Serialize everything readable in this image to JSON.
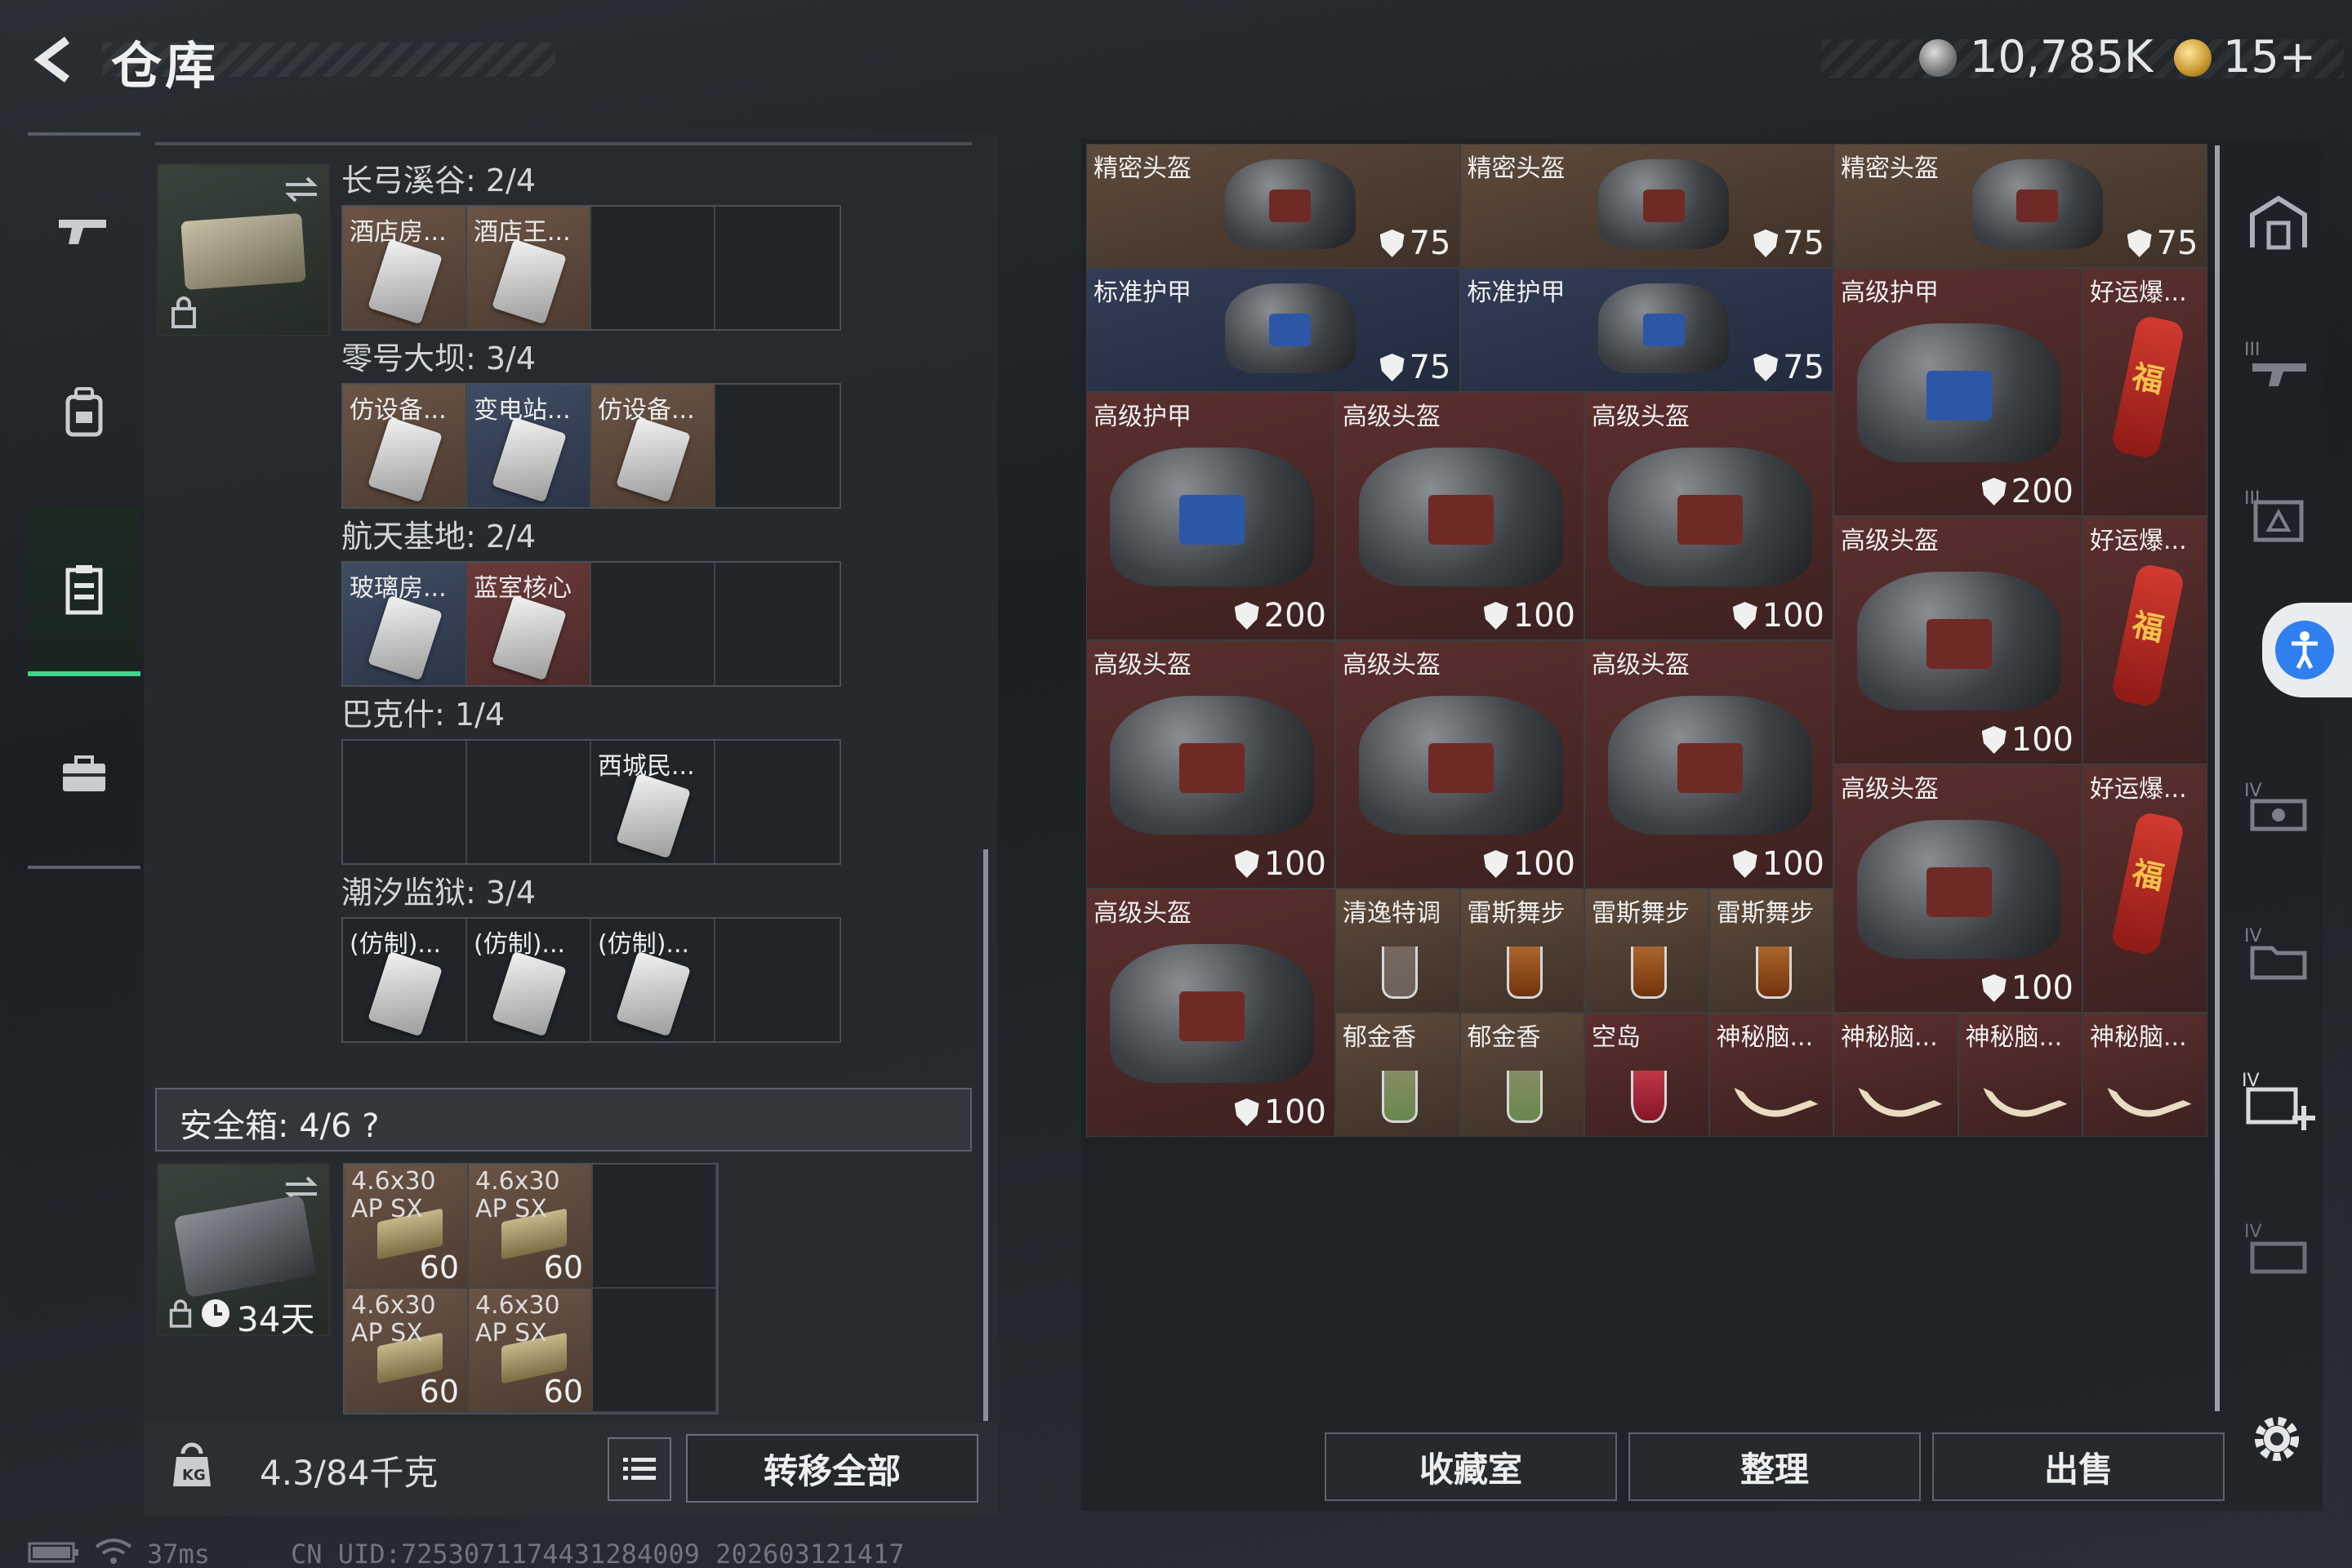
{
  "header": {
    "title": "仓库",
    "currency_silver": "10,785K",
    "currency_gold": "15+"
  },
  "left_rail": {
    "items": [
      "gun-icon",
      "backpack-icon",
      "storage-icon",
      "briefcase-icon"
    ],
    "active_index": 2
  },
  "key_container": {
    "maps": [
      {
        "title": "长弓溪谷: 2/4",
        "slots": [
          {
            "label": "酒店房...",
            "color": "orange"
          },
          {
            "label": "酒店王...",
            "color": "orange"
          },
          {
            "label": "",
            "color": "empty"
          },
          {
            "label": "",
            "color": "empty"
          }
        ]
      },
      {
        "title": "零号大坝: 3/4",
        "slots": [
          {
            "label": "仿设备...",
            "color": "orange"
          },
          {
            "label": "变电站...",
            "color": "blue"
          },
          {
            "label": "仿设备...",
            "color": "orange"
          },
          {
            "label": "",
            "color": "empty"
          }
        ]
      },
      {
        "title": "航天基地: 2/4",
        "slots": [
          {
            "label": "玻璃房...",
            "color": "blue"
          },
          {
            "label": "蓝室核心",
            "color": "red"
          },
          {
            "label": "",
            "color": "empty"
          },
          {
            "label": "",
            "color": "empty"
          }
        ]
      },
      {
        "title": "巴克什: 1/4",
        "slots": [
          {
            "label": "",
            "color": "empty"
          },
          {
            "label": "",
            "color": "empty"
          },
          {
            "label": "西城民...",
            "color": "empty"
          },
          {
            "label": "",
            "color": "empty"
          }
        ]
      },
      {
        "title": "潮汐监狱: 3/4",
        "slots": [
          {
            "label": "(仿制)...",
            "color": "empty"
          },
          {
            "label": "(仿制)...",
            "color": "empty"
          },
          {
            "label": "(仿制)...",
            "color": "empty"
          },
          {
            "label": "",
            "color": "empty"
          }
        ]
      }
    ]
  },
  "safe_box": {
    "title": "安全箱:  4/6  ?",
    "timer": "34天",
    "ammo": [
      {
        "line1": "4.6x30",
        "line2": "AP SX",
        "count": "60"
      },
      {
        "line1": "4.6x30",
        "line2": "AP SX",
        "count": "60"
      },
      {
        "line1": "4.6x30",
        "line2": "AP SX",
        "count": "60"
      },
      {
        "line1": "4.6x30",
        "line2": "AP SX",
        "count": "60"
      }
    ]
  },
  "footer_left": {
    "weight": "4.3/84千克",
    "transfer_all": "转移全部"
  },
  "inventory": {
    "items": [
      {
        "label": "精密头盔",
        "type": "helmet",
        "visor": "red",
        "dur": "75",
        "color": "orange"
      },
      {
        "label": "精密头盔",
        "type": "helmet",
        "visor": "red",
        "dur": "75",
        "color": "orange"
      },
      {
        "label": "精密头盔",
        "type": "helmet",
        "visor": "red",
        "dur": "75",
        "color": "orange"
      },
      {
        "label": "标准护甲",
        "type": "helmet",
        "visor": "blue",
        "dur": "75",
        "color": "blue"
      },
      {
        "label": "标准护甲",
        "type": "helmet",
        "visor": "blue",
        "dur": "75",
        "color": "blue"
      },
      {
        "label": "高级护甲",
        "type": "helmet",
        "visor": "blue",
        "dur": "200",
        "color": "red"
      },
      {
        "label": "好运爆...",
        "type": "firework",
        "color": "red"
      },
      {
        "label": "高级护甲",
        "type": "helmet",
        "visor": "blue",
        "dur": "200",
        "color": "red"
      },
      {
        "label": "高级头盔",
        "type": "helmet",
        "visor": "red",
        "dur": "100",
        "color": "red"
      },
      {
        "label": "高级头盔",
        "type": "helmet",
        "visor": "red",
        "dur": "100",
        "color": "red"
      },
      {
        "label": "高级头盔",
        "type": "helmet",
        "visor": "red",
        "dur": "100",
        "color": "red"
      },
      {
        "label": "好运爆...",
        "type": "firework",
        "color": "red"
      },
      {
        "label": "高级头盔",
        "type": "helmet",
        "visor": "red",
        "dur": "100",
        "color": "red"
      },
      {
        "label": "高级头盔",
        "type": "helmet",
        "visor": "red",
        "dur": "100",
        "color": "red"
      },
      {
        "label": "高级头盔",
        "type": "helmet",
        "visor": "red",
        "dur": "100",
        "color": "red"
      },
      {
        "label": "高级头盔",
        "type": "helmet",
        "visor": "red",
        "dur": "100",
        "color": "red"
      },
      {
        "label": "好运爆...",
        "type": "firework",
        "color": "red"
      },
      {
        "label": "高级头盔",
        "type": "helmet",
        "visor": "red",
        "dur": "100",
        "color": "red"
      },
      {
        "label": "清逸特调",
        "type": "glass",
        "glass": "clear",
        "color": "orange"
      },
      {
        "label": "雷斯舞步",
        "type": "glass",
        "glass": "amber",
        "color": "orange"
      },
      {
        "label": "雷斯舞步",
        "type": "glass",
        "glass": "amber",
        "color": "orange"
      },
      {
        "label": "雷斯舞步",
        "type": "glass",
        "glass": "amber",
        "color": "orange"
      },
      {
        "label": "郁金香",
        "type": "glass",
        "glass": "green",
        "color": "orange"
      },
      {
        "label": "郁金香",
        "type": "glass",
        "glass": "green",
        "color": "orange"
      },
      {
        "label": "空岛",
        "type": "glass",
        "glass": "pink",
        "color": "red"
      },
      {
        "label": "神秘脑...",
        "type": "horn",
        "color": "red"
      },
      {
        "label": "神秘脑...",
        "type": "horn",
        "color": "red"
      },
      {
        "label": "神秘脑...",
        "type": "horn",
        "color": "red"
      },
      {
        "label": "神秘脑...",
        "type": "horn",
        "color": "red"
      }
    ]
  },
  "actions": {
    "collection": "收藏室",
    "sort": "整理",
    "sell": "出售"
  },
  "status": {
    "ping": "37ms",
    "uid": "CN UID:7253071174431284009_202603121417"
  },
  "colors": {
    "accent_green": "#3fd48a",
    "access_blue": "#2f7ff0"
  }
}
